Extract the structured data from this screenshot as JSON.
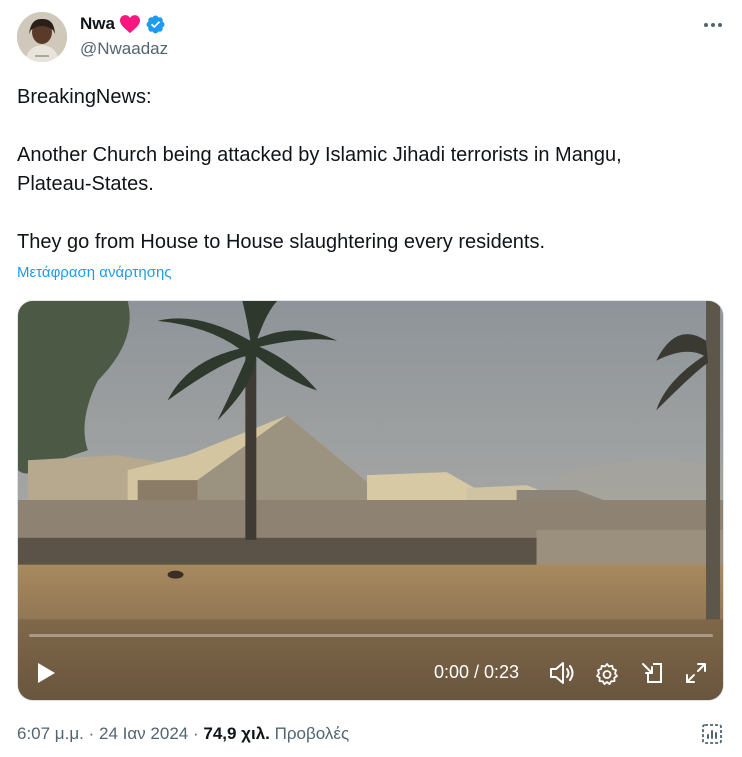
{
  "author": {
    "display_name": "Nwa",
    "handle": "@Nwaadaz",
    "icons": [
      "heart-icon",
      "verified-icon"
    ],
    "heart_color": "#f91880",
    "verified_color": "#1d9bf0"
  },
  "tweet": {
    "lines": [
      "BreakingNews:",
      "Another Church being attacked by Islamic Jihadi terrorists in Mangu, Plateau-States.",
      "They go from House to House slaughtering every residents."
    ],
    "translate_label": "Μετάφραση ανάρτησης"
  },
  "video": {
    "time": "0:00 / 0:23",
    "progress": 0,
    "controls": [
      "play-icon",
      "volume-icon",
      "settings-icon",
      "picture-in-picture-icon",
      "fullscreen-icon"
    ]
  },
  "meta": {
    "time": "6:07 μ.μ.",
    "separator": "·",
    "date": "24 Ιαν 2024",
    "views_count": "74,9 χιλ.",
    "views_label": "Προβολές"
  },
  "colors": {
    "text_primary": "#0f1419",
    "text_secondary": "#536471",
    "link": "#1d9bf0"
  }
}
